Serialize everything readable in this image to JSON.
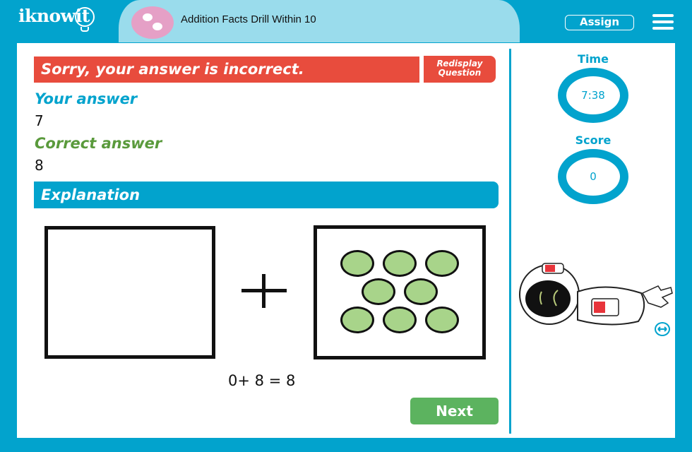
{
  "header": {
    "logo_text": "iknowit",
    "title": "Addition Facts Drill Within 10",
    "assign_label": "Assign",
    "menu_icon": "hamburger-menu-icon"
  },
  "feedback": {
    "message": "Sorry, your answer is incorrect.",
    "redisplay_label_line1": "Redisplay",
    "redisplay_label_line2": "Question",
    "your_answer_label": "Your answer",
    "your_answer_value": "7",
    "correct_answer_label": "Correct answer",
    "correct_answer_value": "8"
  },
  "explanation": {
    "heading": "Explanation",
    "left_count": 0,
    "right_count": 8,
    "operator_icon": "plus-icon",
    "equation": "0+ 8 = 8",
    "counter_color": "#a8d48a"
  },
  "next_label": "Next",
  "sidebar": {
    "time_label": "Time",
    "time_value": "7:38",
    "score_label": "Score",
    "score_value": "0",
    "mascot": "astronaut-illustration",
    "swap_icon": "swap-horizontal-icon"
  },
  "colors": {
    "brand_blue": "#02a3cd",
    "light_blue": "#9adcec",
    "error_red": "#e84c3d",
    "success_green": "#5cb35f",
    "correct_label_green": "#5a9a3c",
    "topic_pink": "#e5a0c6"
  }
}
